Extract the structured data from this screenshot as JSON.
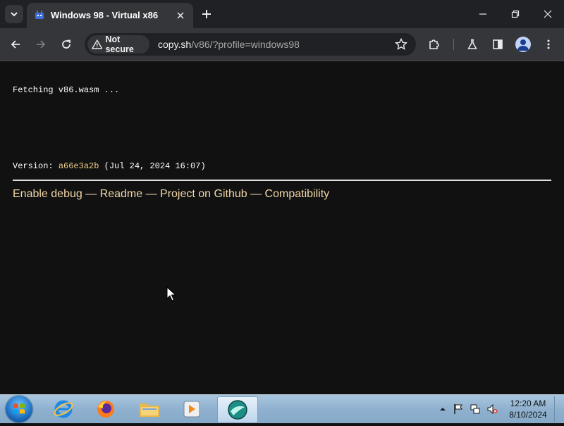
{
  "browser": {
    "tab_title": "Windows 98 - Virtual x86",
    "security_label": "Not secure",
    "url_host": "copy.sh",
    "url_path": "/v86/?profile=windows98"
  },
  "page": {
    "status_text": "Fetching v86.wasm ...",
    "version_prefix": "Version: ",
    "version_hash": "a66e3a2b",
    "version_date": " (Jul 24, 2024 16:07)",
    "links": {
      "enable_debug": "Enable debug",
      "readme": "Readme",
      "github": "Project on Github",
      "compatibility": "Compatibility",
      "separator": " — "
    }
  },
  "taskbar": {
    "apps": [
      "internet-explorer",
      "firefox",
      "file-explorer",
      "media-player",
      "active-app"
    ],
    "time": "12:20 AM",
    "date": "8/10/2024"
  },
  "colors": {
    "page_bg": "#111111",
    "link": "#f0d7a8",
    "hash": "#f2d08a",
    "chrome_dark": "#202124",
    "chrome_toolbar": "#35363a"
  }
}
